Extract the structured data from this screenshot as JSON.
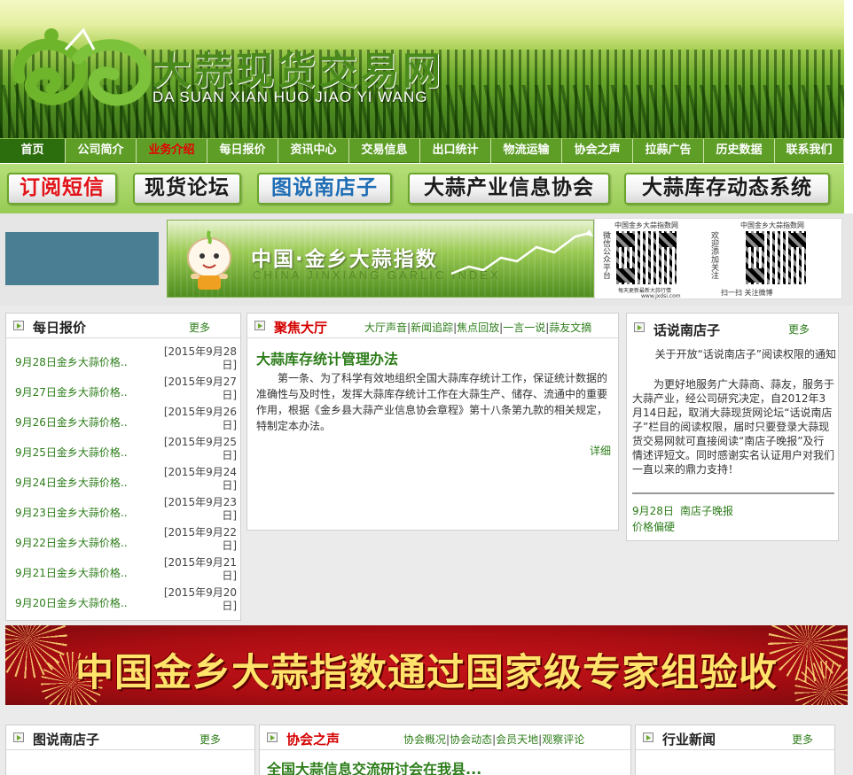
{
  "site": {
    "logo_cn": "大蒜现货交易网",
    "logo_en": "DA SUAN XIAN HUO JIAO YI WANG"
  },
  "nav": {
    "items": [
      {
        "label": "首页"
      },
      {
        "label": "公司简介"
      },
      {
        "label": "业务介绍"
      },
      {
        "label": "每日报价"
      },
      {
        "label": "资讯中心"
      },
      {
        "label": "交易信息"
      },
      {
        "label": "出口统计"
      },
      {
        "label": "物流运输"
      },
      {
        "label": "协会之声"
      },
      {
        "label": "拉蒜广告"
      },
      {
        "label": "历史数据"
      },
      {
        "label": "联系我们"
      }
    ],
    "active_index": 2
  },
  "quick_buttons": [
    {
      "label": "订阅短信"
    },
    {
      "label": "现货论坛"
    },
    {
      "label": "图说南店子"
    },
    {
      "label": "大蒜产业信息协会"
    },
    {
      "label": "大蒜库存动态系统"
    }
  ],
  "index_banner": {
    "title": "中国·金乡大蒜指数",
    "subtitle": "CHINA JINXIANG GARLIC INDEX"
  },
  "qr": {
    "left_caption": "中国金乡大蒜指数网",
    "left_side": "微信公众平台",
    "left_right_side": "欢迎添加关注",
    "left_bottom": "每天更新最新大蒜行情",
    "left_url": "www.jxdsi.com",
    "right_caption": "中国金乡大蒜指数网",
    "right_bottom": "扫一扫 关注微博"
  },
  "daily_price": {
    "title": "每日报价",
    "more": "更多",
    "rows": [
      {
        "name": "9月28日金乡大蒜价格..",
        "date_line1": "[2015年9月28",
        "date_line2": "日]"
      },
      {
        "name": "9月27日金乡大蒜价格..",
        "date_line1": "[2015年9月27",
        "date_line2": "日]"
      },
      {
        "name": "9月26日金乡大蒜价格..",
        "date_line1": "[2015年9月26",
        "date_line2": "日]"
      },
      {
        "name": "9月25日金乡大蒜价格..",
        "date_line1": "[2015年9月25",
        "date_line2": "日]"
      },
      {
        "name": "9月24日金乡大蒜价格..",
        "date_line1": "[2015年9月24",
        "date_line2": "日]"
      },
      {
        "name": "9月23日金乡大蒜价格..",
        "date_line1": "[2015年9月23",
        "date_line2": "日]"
      },
      {
        "name": "9月22日金乡大蒜价格..",
        "date_line1": "[2015年9月22",
        "date_line2": "日]"
      },
      {
        "name": "9月21日金乡大蒜价格..",
        "date_line1": "[2015年9月21",
        "date_line2": "日]"
      },
      {
        "name": "9月20日金乡大蒜价格..",
        "date_line1": "[2015年9月20",
        "date_line2": "日]"
      }
    ]
  },
  "focus": {
    "title": "聚焦大厅",
    "links": [
      "大厅声音",
      "新闻追踪",
      "焦点回放",
      "一言一说",
      "蒜友文摘"
    ],
    "headline": "大蒜库存统计管理办法",
    "body": "第一条、为了科学有效地组织全国大蒜库存统计工作，保证统计数据的准确性与及时性，发挥大蒜库存统计工作在大蒜生产、储存、流通中的重要作用，根据《金乡县大蒜产业信息协会章程》第十八条第九款的相关规定，特制定本办法。",
    "detail": "详细"
  },
  "nandianzi": {
    "title": "话说南店子",
    "more": "更多",
    "notice_title": "关于开放“话说南店子”阅读权限的通知",
    "notice_body": "为更好地服务广大蒜商、蒜友，服务于大蒜产业，经公司研究决定，自2012年3月14日起，取消大蒜现货网论坛“话说南店子”栏目的阅读权限，届时只要登录大蒜现货交易网就可直接阅读“南店子晚报”及行情述评短文。同时感谢实名认证用户对我们一直以来的鼎力支持！",
    "link_date": "9月28日",
    "link_text": "南店子晚报",
    "link2": "价格偏硬"
  },
  "red_banner": {
    "text": "中国金乡大蒜指数通过国家级专家组验收"
  },
  "bottom": {
    "pics": {
      "title": "图说南店子",
      "more": "更多"
    },
    "assoc": {
      "title": "协会之声",
      "links": [
        "协会概况",
        "协会动态",
        "会员天地",
        "观察评论"
      ],
      "headline": "全国大蒜信息交流研讨会在我县..."
    },
    "news": {
      "title": "行业新闻",
      "more": "更多"
    }
  },
  "colors": {
    "nav_green": "#5e9e27",
    "link_green": "#2d7d1a",
    "accent_red": "#d40000",
    "banner_red": "#a80d12"
  }
}
